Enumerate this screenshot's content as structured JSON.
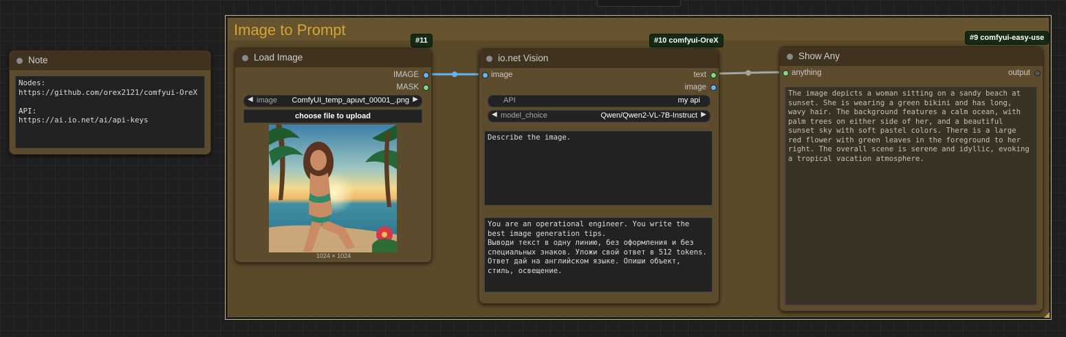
{
  "group": {
    "title": "Image to Prompt"
  },
  "note": {
    "title": "Note",
    "text": "Nodes:\nhttps://github.com/orex2121/comfyui-OreX\n\nAPI:\nhttps://ai.io.net/ai/api-keys"
  },
  "load_image": {
    "badge": "#11",
    "title": "Load Image",
    "outputs": [
      "IMAGE",
      "MASK"
    ],
    "image_widget": {
      "label": "image",
      "value": "ComfyUI_temp_apuvt_00001_.png"
    },
    "upload_label": "choose file to upload",
    "preview_caption": "1024 × 1024"
  },
  "vision": {
    "badge": "#10 comfyui-OreX",
    "title": "io.net Vision",
    "input": "image",
    "outputs": [
      "text",
      "image"
    ],
    "api_widget": {
      "label": "API",
      "value": "my api"
    },
    "model_widget": {
      "label": "model_choice",
      "value": "Qwen/Qwen2-VL-7B-Instruct"
    },
    "prompt": "Describe the image.",
    "system_prompt": "You are an operational engineer. You write the best image generation tips.\nВыводи текст в одну линию, без оформления и без специальных знаков. Уложи свой ответ в 512 tokens. Ответ дай на английском языке. Опиши объект, стиль, освещение."
  },
  "show_any": {
    "badge": "#9 comfyui-easy-use",
    "title": "Show Any",
    "input": "anything",
    "output": "output",
    "text": "The image depicts a woman sitting on a sandy beach at sunset. She is wearing a green bikini and has long, wavy hair. The background features a calm ocean, with palm trees on either side of her, and a beautiful sunset sky with soft pastel colors. There is a large red flower with green leaves in the foreground to her right. The overall scene is serene and idyllic, evoking a tropical vacation atmosphere."
  },
  "colors": {
    "image_link": "#64b5f6",
    "text_link": "#7fd67f",
    "any_link": "#a0a8a0",
    "group_title": "#d4a437"
  }
}
